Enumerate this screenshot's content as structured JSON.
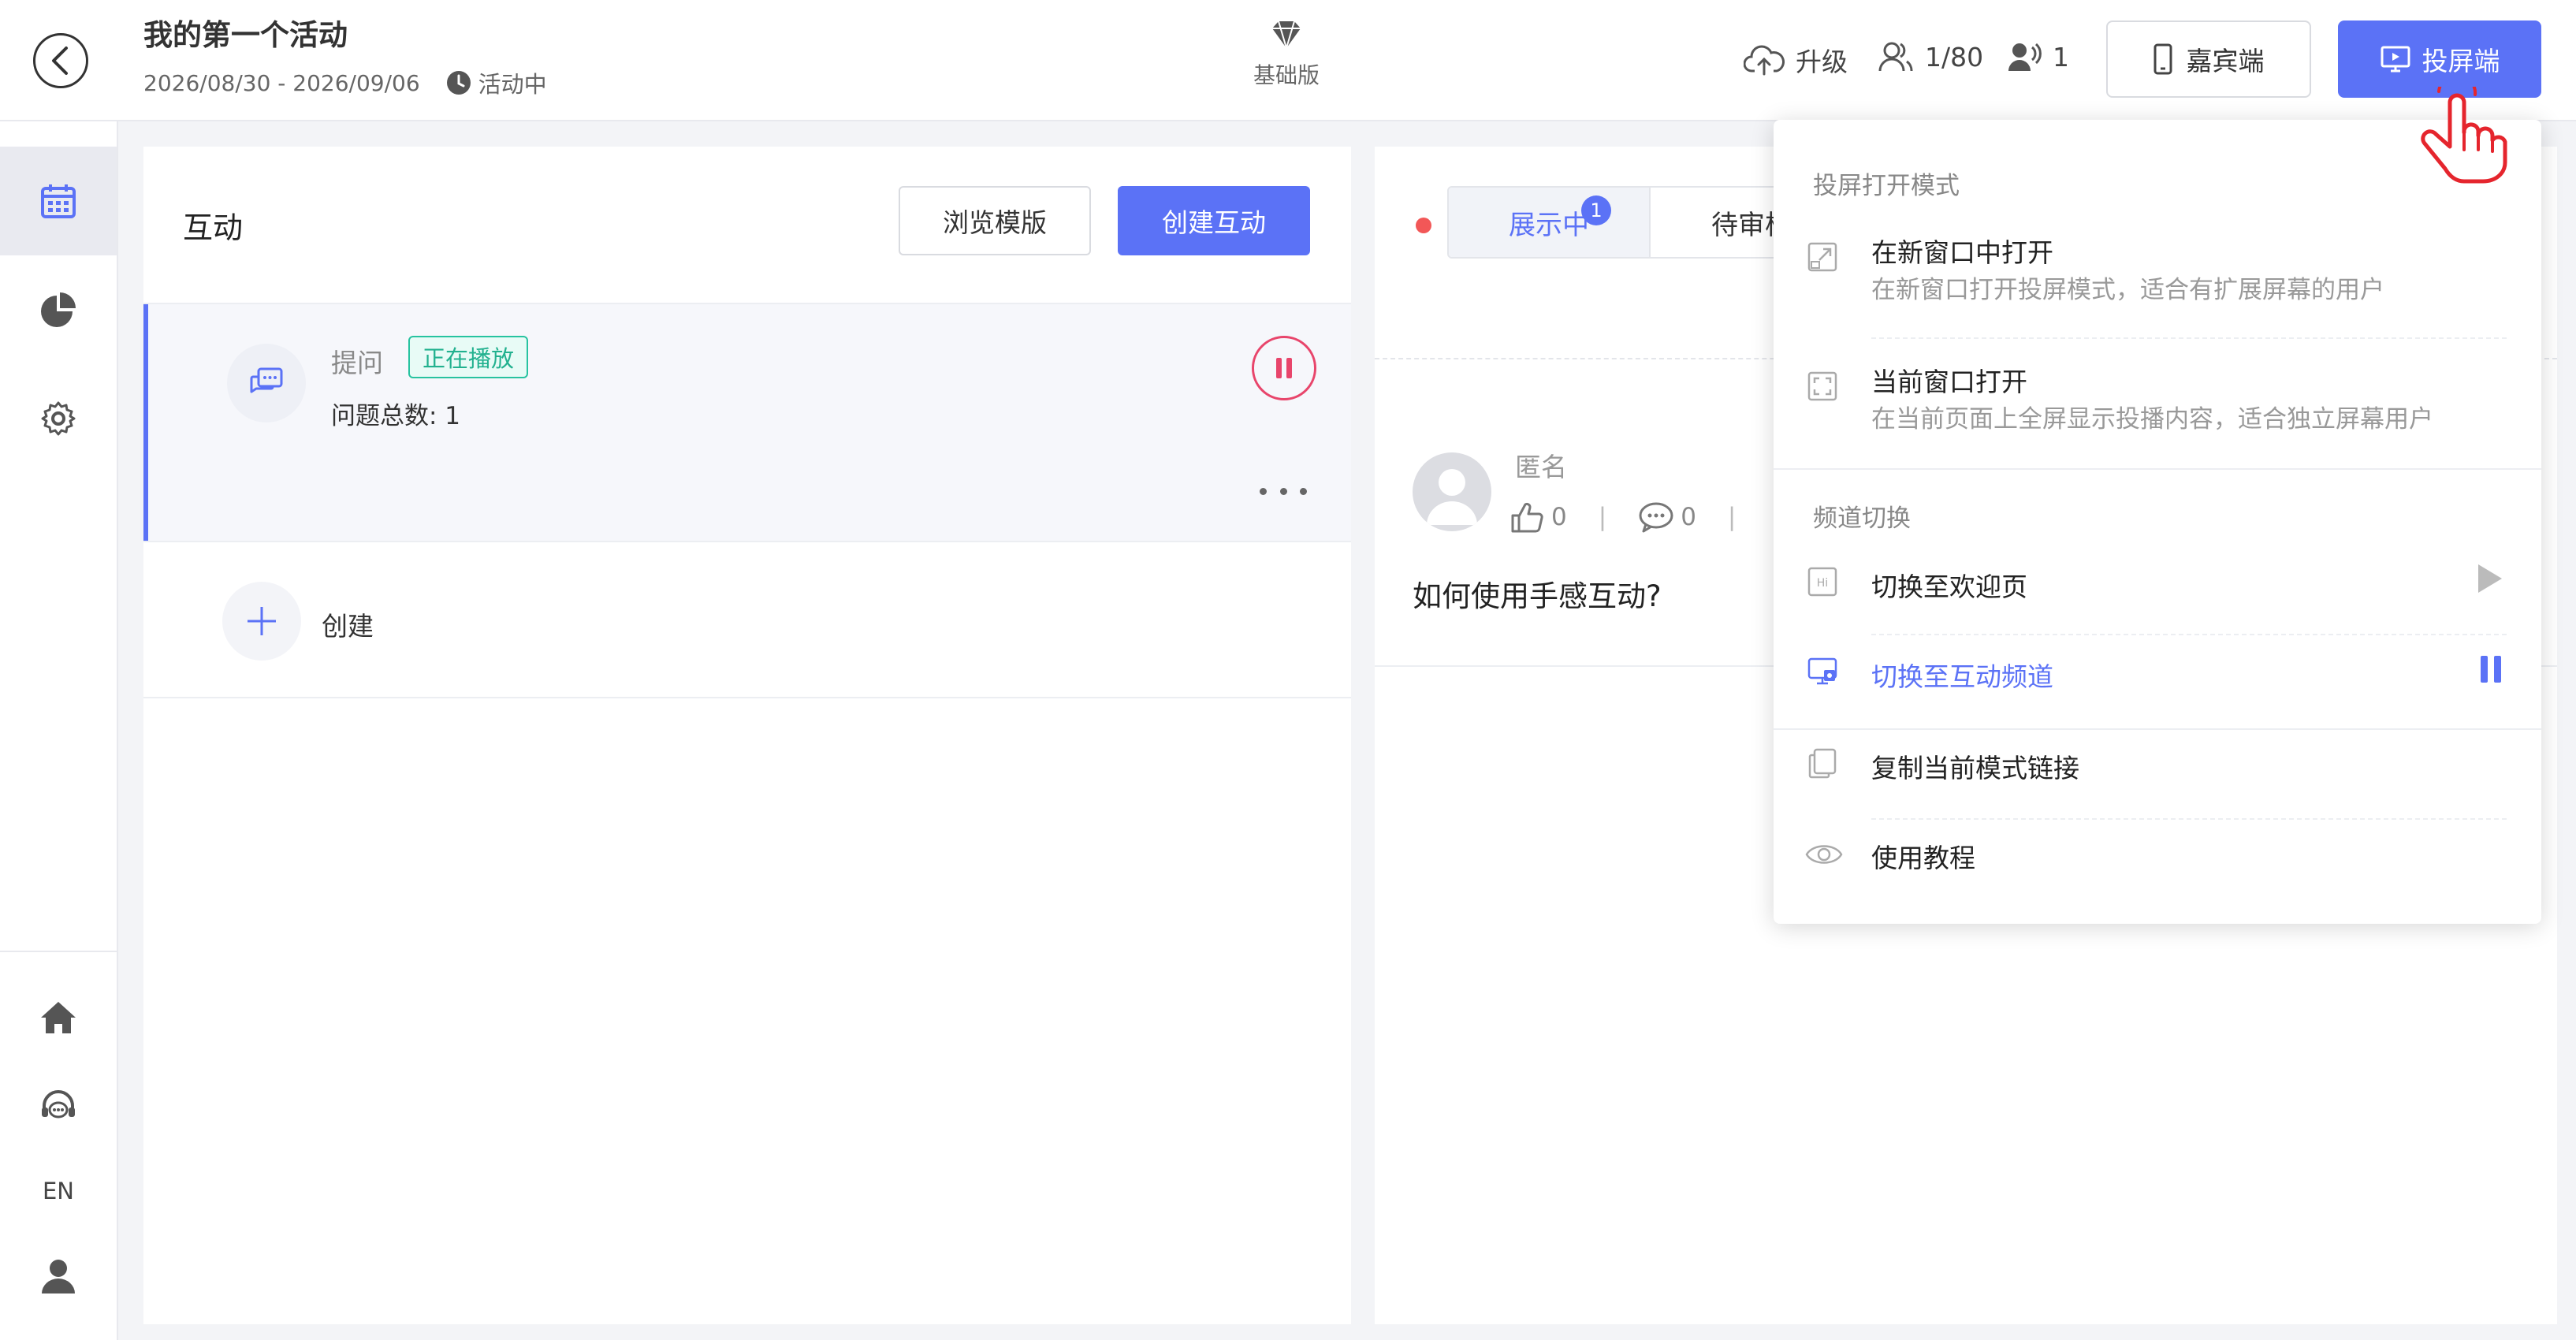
{
  "header": {
    "event_title": "我的第一个活动",
    "date_range": "2026/08/30 - 2026/09/06",
    "status": "活动中",
    "plan_label": "基础版",
    "upgrade_label": "升级",
    "participants": "1/80",
    "online_count": "1",
    "guest_button": "嘉宾端",
    "screen_button": "投屏端"
  },
  "sidebar": {
    "lang_label": "EN"
  },
  "left_panel": {
    "title": "互动",
    "browse_button": "浏览模版",
    "create_button": "创建互动",
    "card": {
      "type": "提问",
      "badge": "正在播放",
      "count_label": "问题总数: 1"
    },
    "create_label": "创建"
  },
  "right_panel": {
    "tabs": [
      {
        "label": "展示中",
        "count": "1"
      },
      {
        "label": "待审核"
      }
    ],
    "question": {
      "author": "匿名",
      "likes": "0",
      "comments": "0",
      "text": "如何使用手感互动?"
    }
  },
  "dropdown": {
    "section_mode": "投屏打开模式",
    "open_new": {
      "title": "在新窗口中打开",
      "desc": "在新窗口打开投屏模式，适合有扩展屏幕的用户"
    },
    "open_current": {
      "title": "当前窗口打开",
      "desc": "在当前页面上全屏显示投播内容，适合独立屏幕用户"
    },
    "section_channel": "频道切换",
    "to_welcome": "切换至欢迎页",
    "to_interactive": "切换至互动频道",
    "copy_link": "复制当前模式链接",
    "tutorial": "使用教程"
  },
  "colors": {
    "accent": "#5b72f6",
    "playing_badge": "#22b18f",
    "pause": "#e8456b",
    "live_dot": "#f25757",
    "cursor_hand": "#e5252d"
  }
}
